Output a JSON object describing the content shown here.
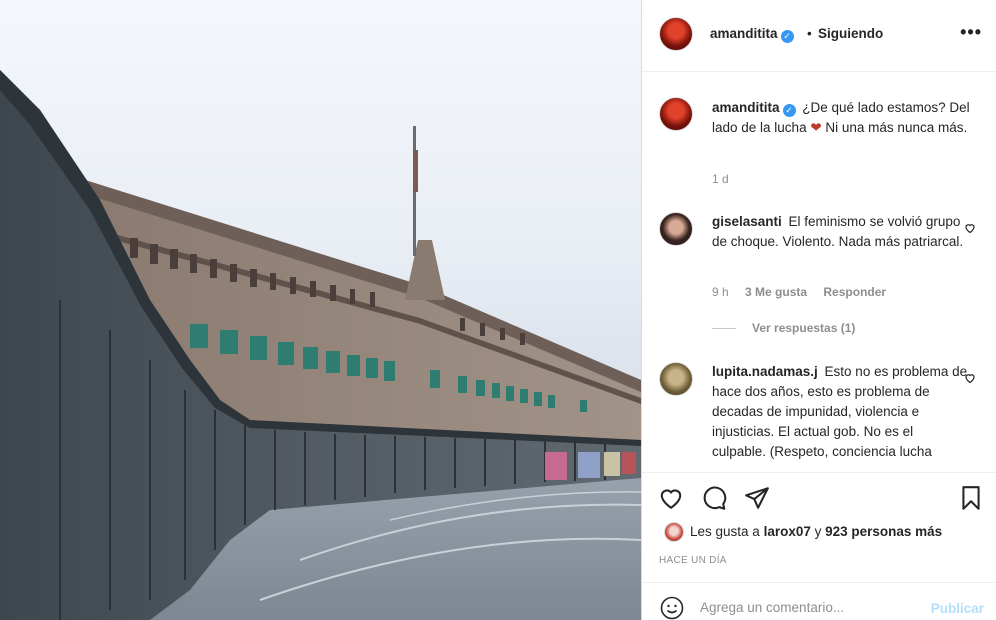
{
  "header": {
    "username": "amanditita",
    "separator": "•",
    "follow_status": "Siguiendo",
    "more_label": "•••"
  },
  "caption": {
    "username": "amanditita",
    "text_before_heart": "¿De qué lado estamos? Del lado de la lucha",
    "heart": "❤",
    "text_after_heart": " Ni una más nunca más.",
    "time": "1 d"
  },
  "comments": [
    {
      "username": "giselasanti",
      "text": "El feminismo se volvió grupo de choque. Violento. Nada más patriarcal.",
      "time": "9 h",
      "likes": "3 Me gusta",
      "reply": "Responder",
      "view_replies": "Ver respuestas (1)"
    },
    {
      "username": "lupita.nadamas.j",
      "text": "Esto no es problema de hace dos años, esto es problema de decadas de impunidad, violencia e injusticias. El actual gob. No es el culpable. (Respeto, conciencia lucha"
    }
  ],
  "likes": {
    "prefix": "Les gusta a ",
    "user": "larox07",
    "middle": " y ",
    "others": "923 personas más"
  },
  "timestamp": "HACE UN DÍA",
  "add_comment": {
    "placeholder": "Agrega un comentario...",
    "post_label": "Publicar"
  },
  "icons": {
    "like": "heart-icon",
    "comment": "comment-icon",
    "share": "share-icon",
    "save": "bookmark-icon",
    "emoji": "emoji-icon",
    "verified": "verified-badge-icon",
    "more": "more-options-icon"
  },
  "colors": {
    "verified": "#3897f0",
    "link_disabled": "#b2dffc",
    "muted": "#8e8e8e",
    "heart": "#c0392b"
  }
}
